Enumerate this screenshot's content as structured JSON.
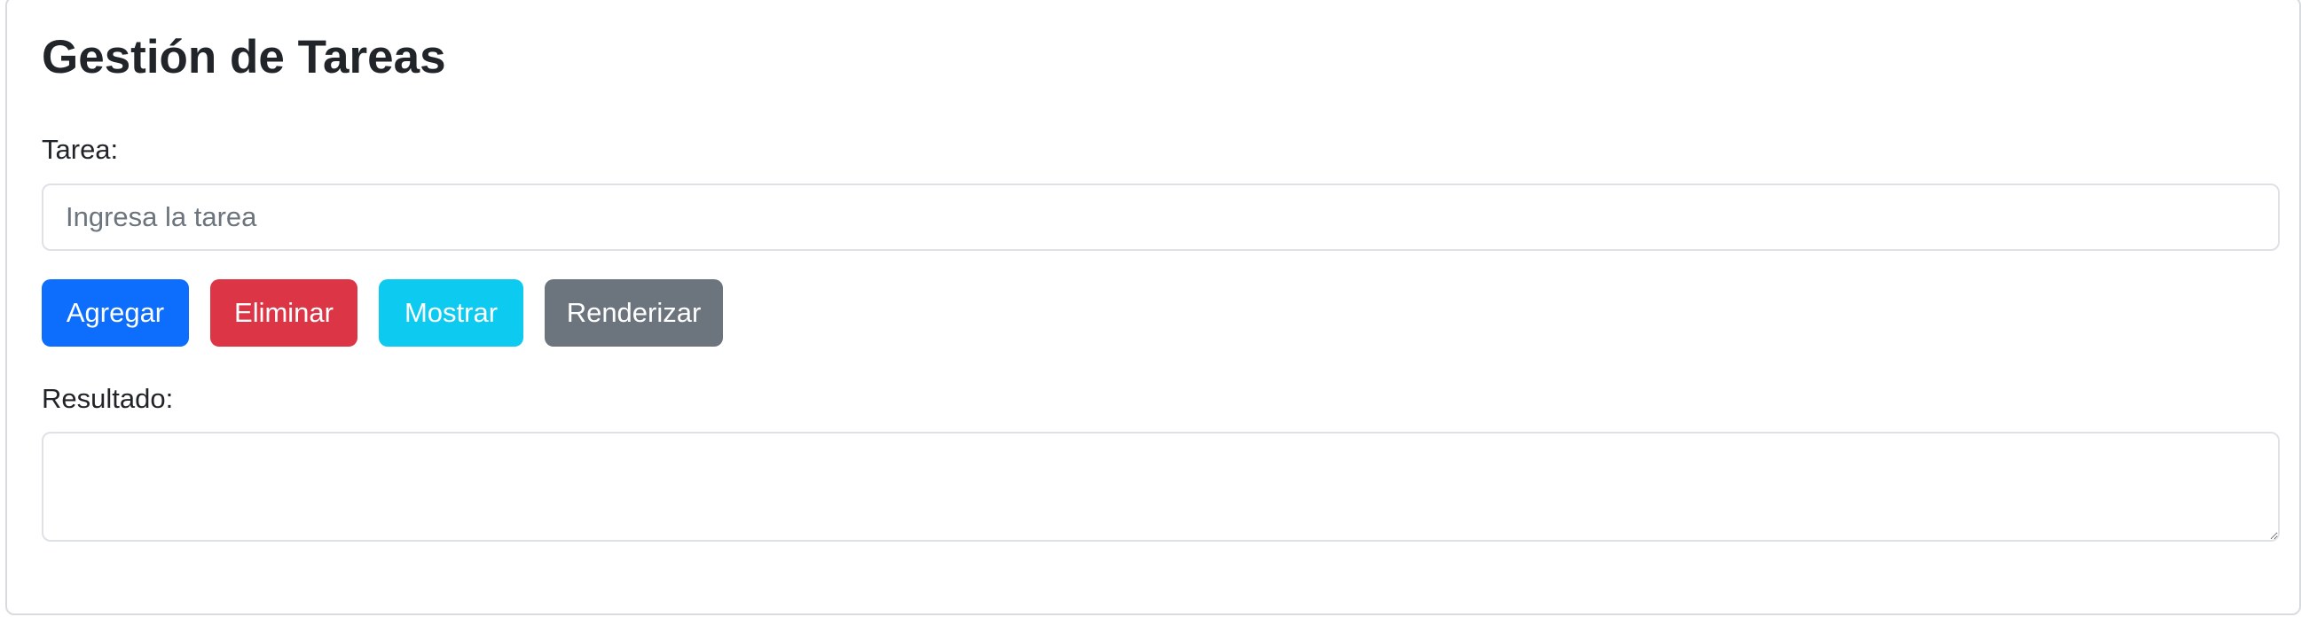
{
  "page": {
    "title": "Gestión de Tareas"
  },
  "task_field": {
    "label": "Tarea:",
    "value": "",
    "placeholder": "Ingresa la tarea"
  },
  "buttons": {
    "add": "Agregar",
    "delete": "Eliminar",
    "show": "Mostrar",
    "render": "Renderizar"
  },
  "result_field": {
    "label": "Resultado:",
    "value": ""
  },
  "colors": {
    "add": "#0d6efd",
    "delete": "#dc3545",
    "show": "#0dcaf0",
    "render": "#6c757d"
  }
}
